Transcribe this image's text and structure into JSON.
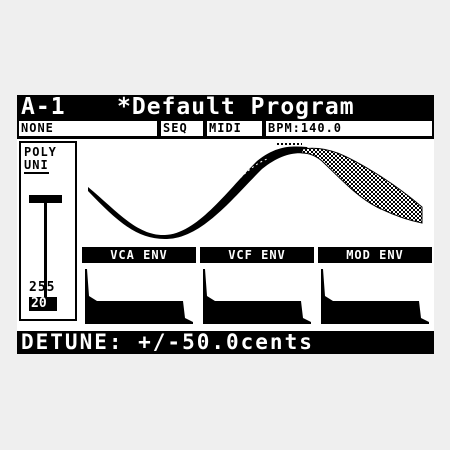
{
  "header": {
    "program_id": "A-1",
    "program_name": "*Default Program"
  },
  "status": {
    "group": "NONE",
    "seq": "SEQ",
    "midi": "MIDI",
    "bpm": "BPM:140.0"
  },
  "voice_mode": {
    "options": [
      "POLY",
      "UNI"
    ],
    "selected": "UNI",
    "value_max": "255",
    "value_min": "20",
    "level": 0.0
  },
  "envelopes": [
    {
      "label": "VCA ENV"
    },
    {
      "label": "VCF ENV"
    },
    {
      "label": "MOD ENV"
    }
  ],
  "parameter": {
    "text": "DETUNE: +/-50.0cents"
  },
  "colors": {
    "foreground": "#000000",
    "background": "#ffffff",
    "bezel": "#efefef"
  }
}
